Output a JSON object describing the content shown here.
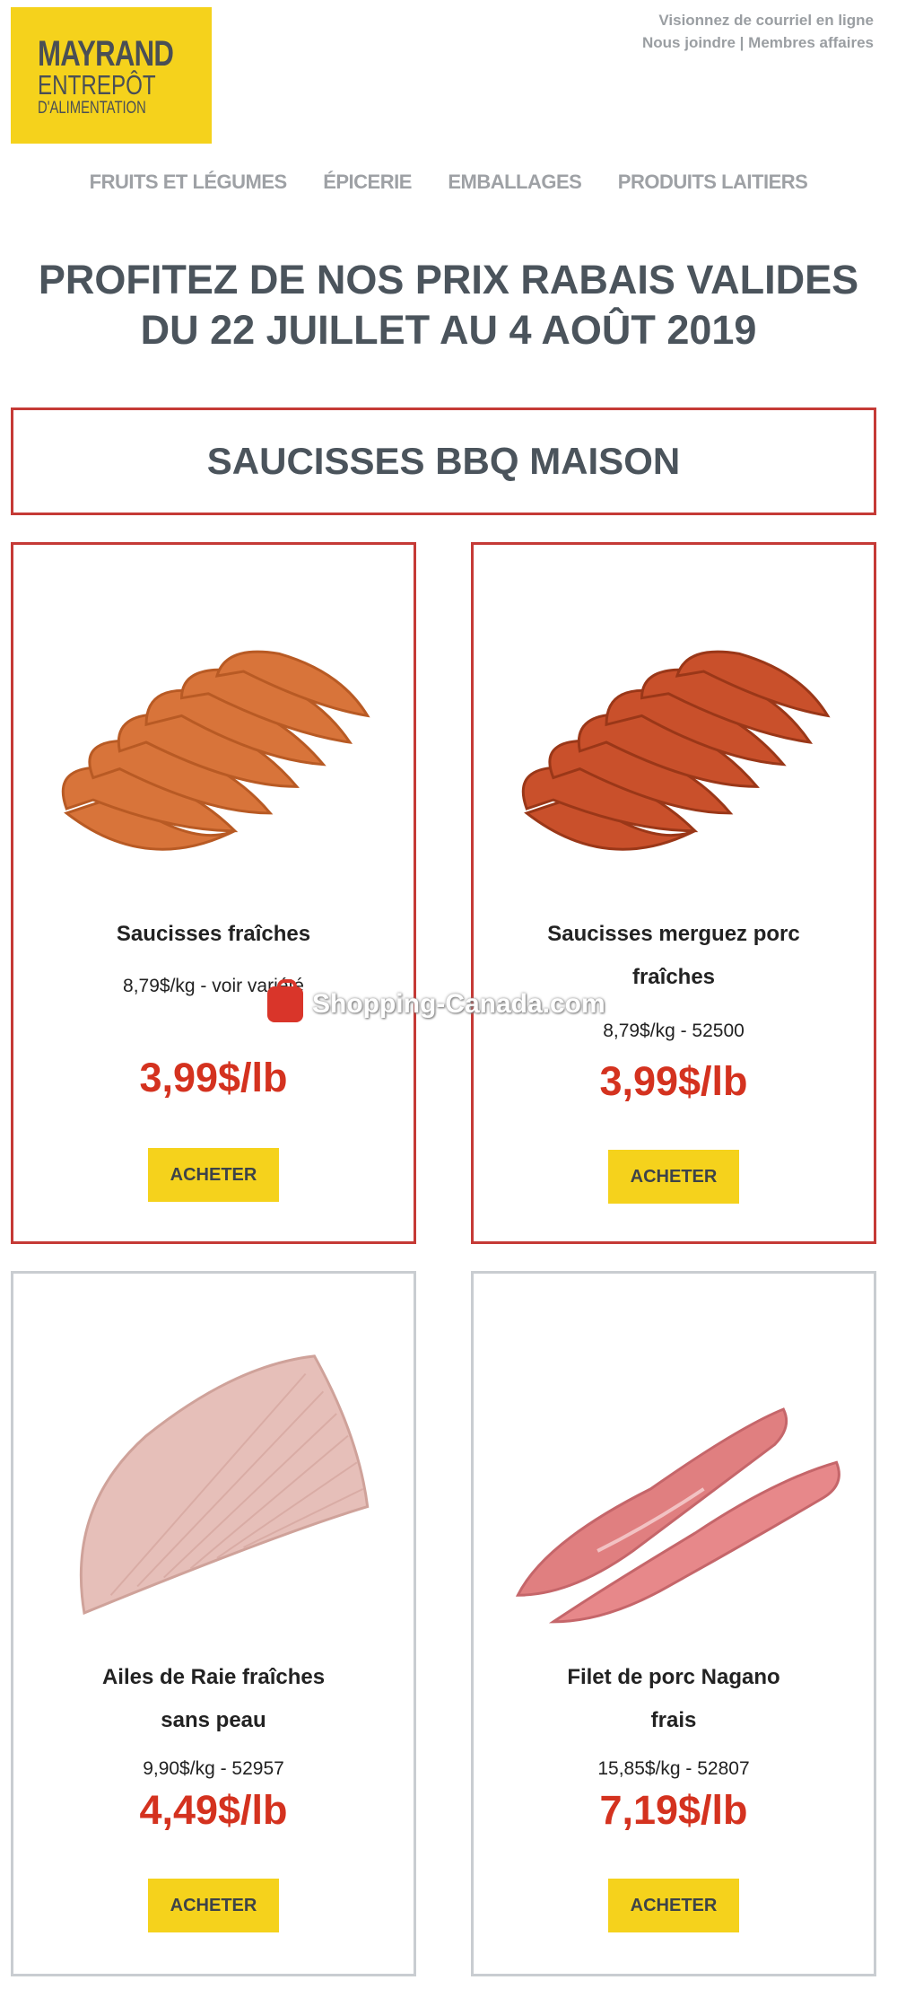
{
  "logo": {
    "brand": "MAYRAND",
    "line1": "ENTREPÔT",
    "line2": "D'ALIMENTATION"
  },
  "toplinks": {
    "view_online": "Visionnez de courriel en ligne",
    "contact": "Nous joindre",
    "separator": "|",
    "members": "Membres affaires"
  },
  "nav": {
    "items": [
      {
        "label": "FRUITS ET LÉGUMES"
      },
      {
        "label": "ÉPICERIE"
      },
      {
        "label": "EMBALLAGES"
      },
      {
        "label": "PRODUITS LAITIERS"
      }
    ]
  },
  "headline": {
    "line1": "PROFITEZ DE NOS PRIX RABAIS VALIDES",
    "line2": "DU 22 JUILLET AU 4 AOÛT 2019"
  },
  "section": {
    "title": "SAUCISSES BBQ MAISON"
  },
  "products": [
    {
      "name_line1": "Saucisses fraîches",
      "name_line2": "",
      "detail": "8,79$/kg - voir variété",
      "price": "3,99$/lb",
      "buy_label": "ACHETER"
    },
    {
      "name_line1": "Saucisses merguez porc",
      "name_line2": "fraîches",
      "detail": "8,79$/kg - 52500",
      "price": "3,99$/lb",
      "buy_label": "ACHETER"
    },
    {
      "name_line1": "Ailes de Raie fraîches",
      "name_line2": "sans peau",
      "detail": "9,90$/kg - 52957",
      "price": "4,49$/lb",
      "buy_label": "ACHETER"
    },
    {
      "name_line1": "Filet de porc Nagano",
      "name_line2": "frais",
      "detail": "15,85$/kg - 52807",
      "price": "7,19$/lb",
      "buy_label": "ACHETER"
    }
  ],
  "watermark": {
    "text": "Shopping-Canada.com"
  },
  "colors": {
    "accent_yellow": "#f5d21c",
    "price_red": "#d4321f",
    "border_red": "#c53a36",
    "heading_grey": "#4b545c"
  }
}
